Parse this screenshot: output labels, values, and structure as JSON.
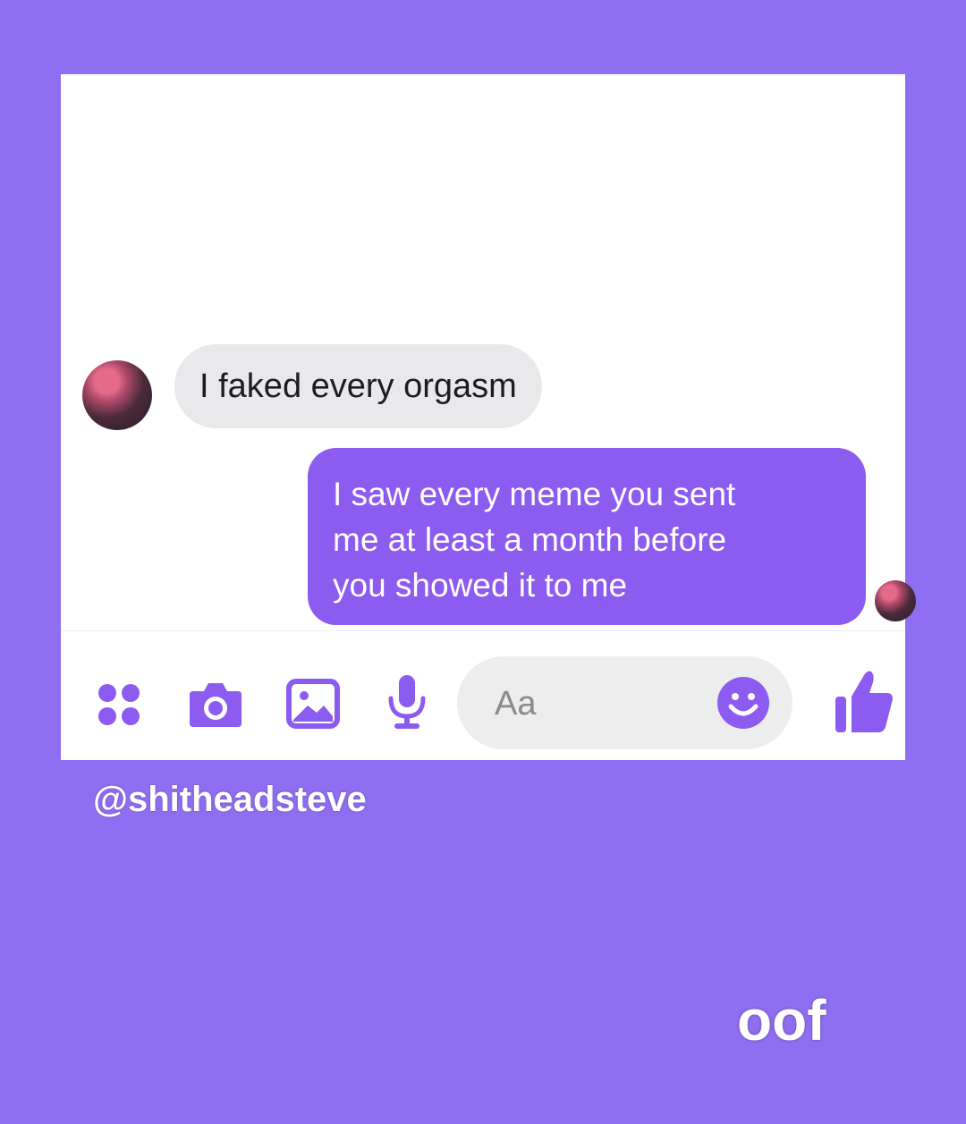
{
  "conversation": {
    "received_message": "I faked every orgasm",
    "sent_message_lines": [
      "I saw every meme you sent",
      "me at least a month before",
      "you showed it to me"
    ]
  },
  "composer": {
    "placeholder": "Aa"
  },
  "toolbar": {
    "icons": [
      "apps-icon",
      "camera-icon",
      "image-icon",
      "microphone-icon",
      "emoji-icon",
      "thumbs-up-icon"
    ]
  },
  "overlay": {
    "handle": "@shitheadsteve",
    "caption": "oof"
  },
  "colors": {
    "background": "#8f6ef2",
    "accent": "#8c5bf0",
    "received_bubble": "#e9e9eb"
  }
}
